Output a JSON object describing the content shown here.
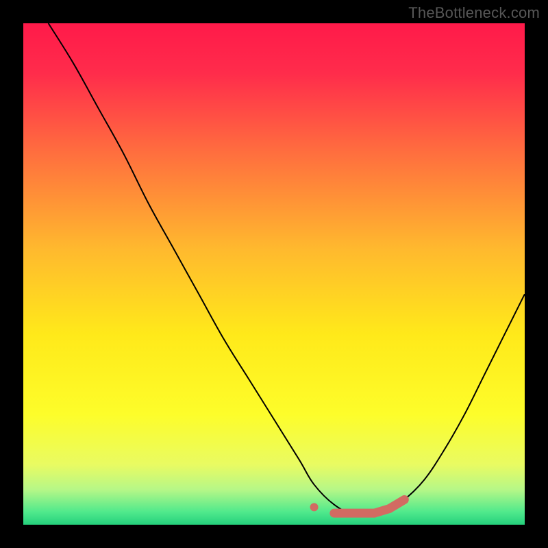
{
  "watermark": "TheBottleneck.com",
  "chart_data": {
    "type": "line",
    "title": "",
    "xlabel": "",
    "ylabel": "",
    "xlim": [
      0,
      100
    ],
    "ylim": [
      0,
      100
    ],
    "grid": false,
    "legend": false,
    "background": {
      "type": "vertical-gradient",
      "stops": [
        {
          "pos": 0.0,
          "color": "#ff1a4a"
        },
        {
          "pos": 0.1,
          "color": "#ff2c4b"
        },
        {
          "pos": 0.25,
          "color": "#ff6b3f"
        },
        {
          "pos": 0.45,
          "color": "#ffb92e"
        },
        {
          "pos": 0.62,
          "color": "#ffe91a"
        },
        {
          "pos": 0.78,
          "color": "#fdfd2a"
        },
        {
          "pos": 0.88,
          "color": "#e9fb62"
        },
        {
          "pos": 0.93,
          "color": "#b6f787"
        },
        {
          "pos": 0.975,
          "color": "#4fe98c"
        },
        {
          "pos": 1.0,
          "color": "#25d07c"
        }
      ]
    },
    "series": [
      {
        "name": "curve",
        "color": "#000000",
        "width": 2,
        "x": [
          5,
          10,
          15,
          20,
          25,
          30,
          35,
          40,
          45,
          50,
          55,
          58,
          62,
          66,
          70,
          73,
          76,
          80,
          84,
          88,
          92,
          96,
          100
        ],
        "y": [
          100,
          92,
          83,
          74,
          64,
          55,
          46,
          37,
          29,
          21,
          13,
          8,
          4,
          2,
          2,
          3,
          5,
          9,
          15,
          22,
          30,
          38,
          46
        ]
      }
    ],
    "markers": [
      {
        "name": "dot",
        "x": 58,
        "y": 3.5,
        "color": "#d26b62",
        "r": 6
      },
      {
        "name": "seg1",
        "x1": 62,
        "y1": 2.3,
        "x2": 70,
        "y2": 2.3,
        "color": "#d26b62",
        "w": 13
      },
      {
        "name": "seg2",
        "x1": 70,
        "y1": 2.3,
        "x2": 73,
        "y2": 3.2,
        "color": "#d26b62",
        "w": 13
      },
      {
        "name": "seg3",
        "x1": 73,
        "y1": 3.2,
        "x2": 76,
        "y2": 5.0,
        "color": "#d26b62",
        "w": 13
      }
    ]
  }
}
